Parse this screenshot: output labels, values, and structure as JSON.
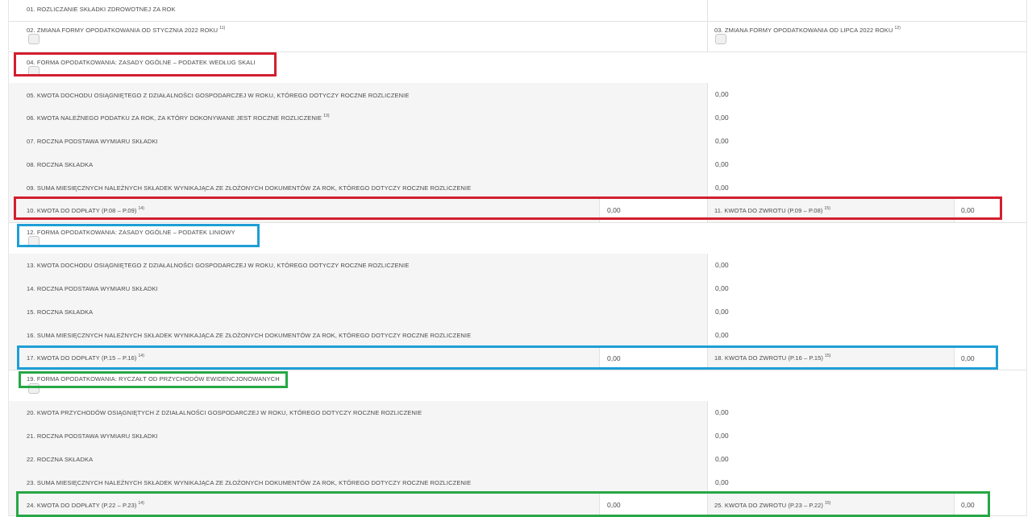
{
  "colors": {
    "red": "#d21f2f",
    "blue": "#1e9fd6",
    "green": "#28a745"
  },
  "rows": {
    "r01": {
      "label": "01. Rozliczanie składki zdrowotnej za rok"
    },
    "r02": {
      "label": "02. Zmiana formy opodatkowania od stycznia 2022 roku",
      "note": "11)"
    },
    "r03": {
      "label": "03. Zmiana formy opodatkowania od lipca 2022 roku",
      "note": "12)"
    },
    "r04": {
      "label": "04. Forma opodatkowania: zasady ogólne – podatek według skali"
    },
    "r05": {
      "label": "05. Kwota dochodu osiągniętego z działalności gospodarczej w roku, którego dotyczy roczne rozliczenie",
      "value": "0,00"
    },
    "r06": {
      "label": "06. Kwota należnego podatku za rok, za który dokonywane jest roczne rozliczenie",
      "note": "13)",
      "value": "0,00"
    },
    "r07": {
      "label": "07. Roczna podstawa wymiaru składki",
      "value": "0,00"
    },
    "r08": {
      "label": "08. Roczna składka",
      "value": "0,00"
    },
    "r09": {
      "label": "09. Suma miesięcznych należnych składek wynikająca ze złożonych dokumentów za rok, którego dotyczy roczne rozliczenie",
      "value": "0,00"
    },
    "r10": {
      "label": "10. Kwota do dopłaty (P.08 – P.09)",
      "note": "14)",
      "value": "0,00"
    },
    "r11": {
      "label": "11. Kwota do zwrotu (P.09 – P.08)",
      "note": "15)",
      "value": "0,00"
    },
    "r12": {
      "label": "12. Forma opodatkowania: zasady ogólne – podatek liniowy"
    },
    "r13": {
      "label": "13. Kwota dochodu osiągniętego z działalności gospodarczej w roku, którego dotyczy roczne rozliczenie",
      "value": "0,00"
    },
    "r14": {
      "label": "14. Roczna podstawa wymiaru składki",
      "value": "0,00"
    },
    "r15": {
      "label": "15. Roczna składka",
      "value": "0,00"
    },
    "r16": {
      "label": "16. Suma miesięcznych należnych składek wynikająca ze złożonych dokumentów za rok, którego dotyczy roczne rozliczenie",
      "value": "0,00"
    },
    "r17": {
      "label": "17. Kwota do dopłaty (P.15 – P.16)",
      "note": "14)",
      "value": "0,00"
    },
    "r18": {
      "label": "18. Kwota do zwrotu (P.16 – P.15)",
      "note": "15)",
      "value": "0,00"
    },
    "r19": {
      "label": "19. Forma opodatkowania: ryczałt od przychodów ewidencjonowanych"
    },
    "r20": {
      "label": "20. Kwota przychodów osiągniętych z działalności gospodarczej w roku, którego dotyczy roczne rozliczenie",
      "value": "0,00"
    },
    "r21": {
      "label": "21. Roczna podstawa wymiaru składki",
      "value": "0,00"
    },
    "r22": {
      "label": "22. Roczna składka",
      "value": "0,00"
    },
    "r23": {
      "label": "23. Suma miesięcznych należnych składek wynikająca ze złożonych dokumentów za rok, którego dotyczy roczne rozliczenie",
      "value": "0,00"
    },
    "r24": {
      "label": "24. Kwota do dopłaty (P.22 – P.23)",
      "note": "14)",
      "value": "0,00"
    },
    "r25": {
      "label": "25. Kwota do zwrotu (P.23 – P.22)",
      "note": "15)",
      "value": "0,00"
    }
  }
}
